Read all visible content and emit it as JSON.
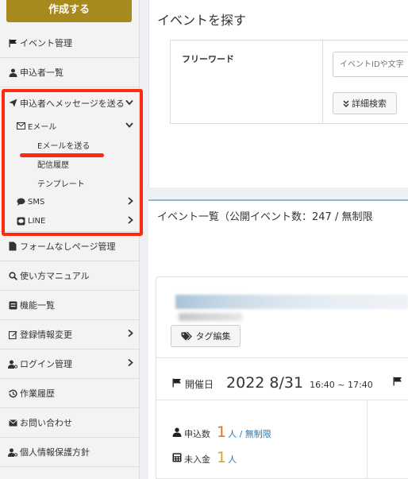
{
  "sidebar": {
    "create_button": "作成する",
    "items": [
      {
        "label": "イベント管理",
        "icon": "flag-icon"
      },
      {
        "label": "申込者一覧",
        "icon": "user-icon"
      },
      {
        "label": "申込者へメッセージを送る",
        "icon": "send-icon"
      },
      {
        "label": "フォームなしページ管理",
        "icon": "file-icon"
      },
      {
        "label": "使い方マニュアル",
        "icon": "search-icon"
      },
      {
        "label": "機能一覧",
        "icon": "list-icon"
      },
      {
        "label": "登録情報変更",
        "icon": "edit-icon"
      },
      {
        "label": "ログイン管理",
        "icon": "user-key-icon"
      },
      {
        "label": "作業履歴",
        "icon": "history-icon"
      },
      {
        "label": "お問い合わせ",
        "icon": "envelope-icon"
      },
      {
        "label": "個人情報保護方針",
        "icon": "user-key-icon"
      }
    ],
    "message_sub": {
      "email_label": "Eメール",
      "email_children": [
        "Eメールを送る",
        "配信履歴",
        "テンプレート"
      ],
      "sms_label": "SMS",
      "line_label": "LINE"
    }
  },
  "search": {
    "title": "イベントを探す",
    "freeword_label": "フリーワード",
    "input_placeholder": "イベントIDや文字",
    "detail_button": "詳細検索"
  },
  "list": {
    "title": "イベント一覧（公開イベント数：247 / 無制限"
  },
  "event_card": {
    "tag_button": "タグ編集",
    "date_label": "開催日",
    "date_value": "2022 8/31",
    "time_value": "16:40 ~ 17:40",
    "applicants_label": "申込数",
    "applicants_count": "1",
    "applicants_unit": "人 / 無制限",
    "unpaid_label": "未入金",
    "unpaid_count": "1",
    "unpaid_unit": "人"
  },
  "colors": {
    "accent_gold": "#a8891e",
    "highlight_red": "#ff2a12",
    "count_orange": "#f06a1b",
    "count_gold": "#e0a21b",
    "link_blue": "#2a79b5"
  }
}
